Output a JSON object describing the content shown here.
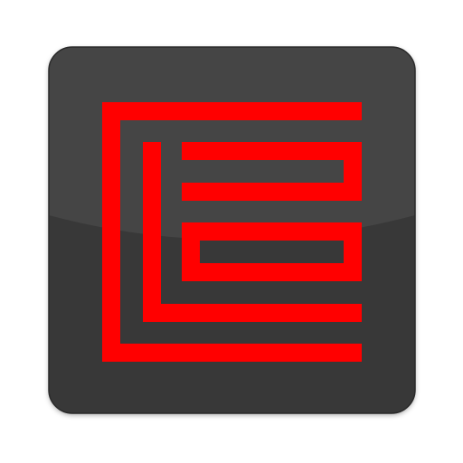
{
  "icon": {
    "name": "maze-logo-icon",
    "colors": {
      "tile_base": "#383838",
      "tile_highlight": "#505050",
      "tile_border": "#2a2a2a",
      "mark": "#ff0000"
    }
  }
}
